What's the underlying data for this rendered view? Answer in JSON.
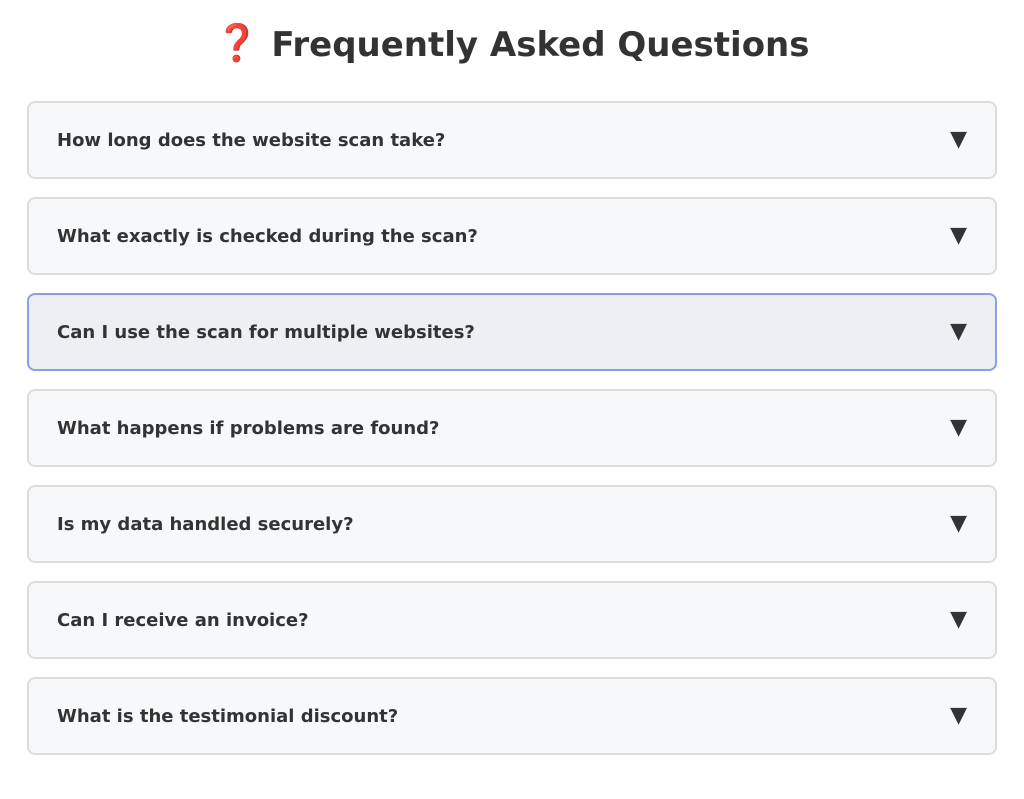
{
  "header": {
    "icon": "question-mark-icon",
    "icon_glyph": "❓",
    "title": "Frequently Asked Questions"
  },
  "faq": {
    "arrow_glyph": "▼",
    "items": [
      {
        "question": "How long does the website scan take?",
        "active": false
      },
      {
        "question": "What exactly is checked during the scan?",
        "active": false
      },
      {
        "question": "Can I use the scan for multiple websites?",
        "active": true
      },
      {
        "question": "What happens if problems are found?",
        "active": false
      },
      {
        "question": "Is my data handled securely?",
        "active": false
      },
      {
        "question": "Can I receive an invoice?",
        "active": false
      },
      {
        "question": "What is the testimonial discount?",
        "active": false
      }
    ]
  },
  "colors": {
    "accent_icon": "#e0303a",
    "active_border": "#8a9fe8",
    "item_background": "#f7f8fa",
    "active_background": "#eeeff3",
    "text": "#333333"
  }
}
